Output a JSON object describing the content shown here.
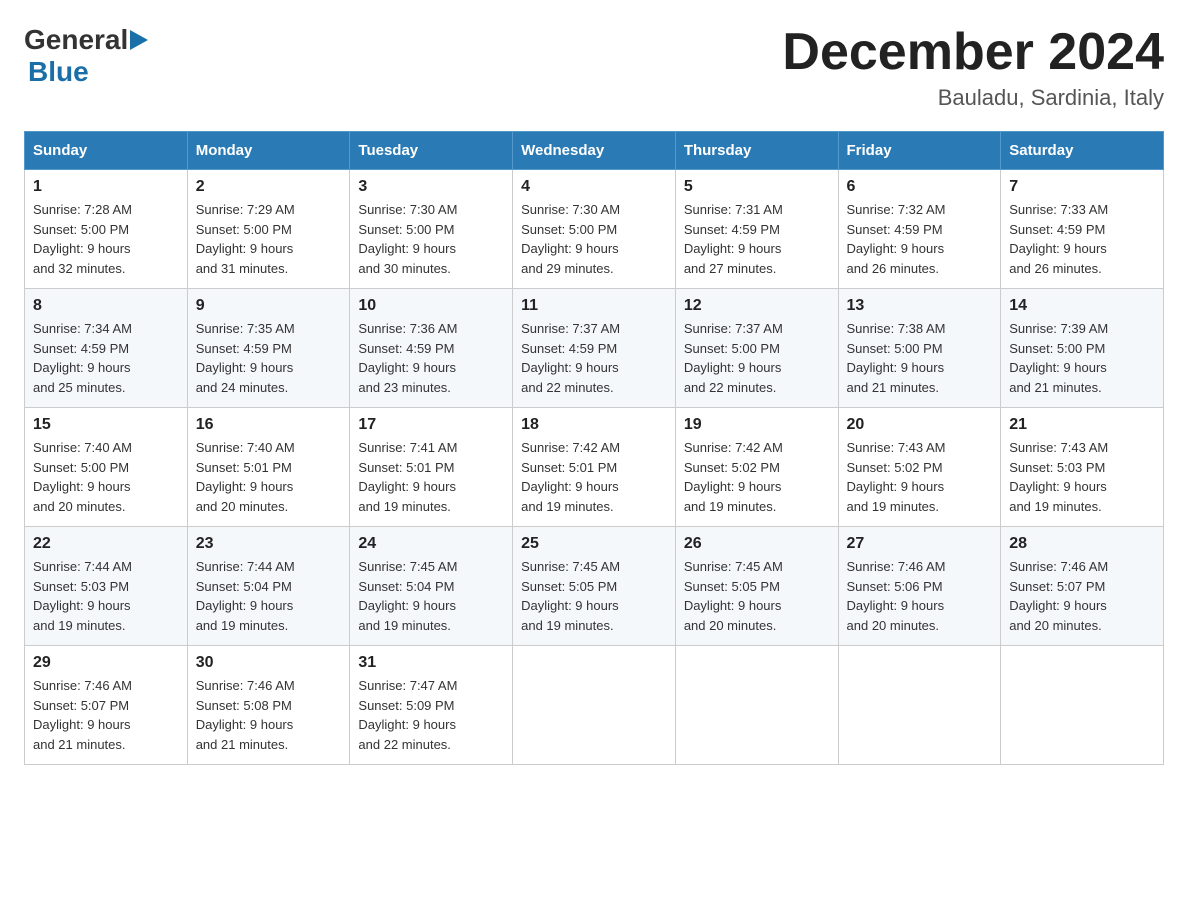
{
  "header": {
    "logo_general": "General",
    "logo_blue": "Blue",
    "title": "December 2024",
    "subtitle": "Bauladu, Sardinia, Italy"
  },
  "days_of_week": [
    "Sunday",
    "Monday",
    "Tuesday",
    "Wednesday",
    "Thursday",
    "Friday",
    "Saturday"
  ],
  "weeks": [
    [
      {
        "day": "1",
        "sunrise": "7:28 AM",
        "sunset": "5:00 PM",
        "daylight": "9 hours and 32 minutes."
      },
      {
        "day": "2",
        "sunrise": "7:29 AM",
        "sunset": "5:00 PM",
        "daylight": "9 hours and 31 minutes."
      },
      {
        "day": "3",
        "sunrise": "7:30 AM",
        "sunset": "5:00 PM",
        "daylight": "9 hours and 30 minutes."
      },
      {
        "day": "4",
        "sunrise": "7:30 AM",
        "sunset": "5:00 PM",
        "daylight": "9 hours and 29 minutes."
      },
      {
        "day": "5",
        "sunrise": "7:31 AM",
        "sunset": "4:59 PM",
        "daylight": "9 hours and 27 minutes."
      },
      {
        "day": "6",
        "sunrise": "7:32 AM",
        "sunset": "4:59 PM",
        "daylight": "9 hours and 26 minutes."
      },
      {
        "day": "7",
        "sunrise": "7:33 AM",
        "sunset": "4:59 PM",
        "daylight": "9 hours and 26 minutes."
      }
    ],
    [
      {
        "day": "8",
        "sunrise": "7:34 AM",
        "sunset": "4:59 PM",
        "daylight": "9 hours and 25 minutes."
      },
      {
        "day": "9",
        "sunrise": "7:35 AM",
        "sunset": "4:59 PM",
        "daylight": "9 hours and 24 minutes."
      },
      {
        "day": "10",
        "sunrise": "7:36 AM",
        "sunset": "4:59 PM",
        "daylight": "9 hours and 23 minutes."
      },
      {
        "day": "11",
        "sunrise": "7:37 AM",
        "sunset": "4:59 PM",
        "daylight": "9 hours and 22 minutes."
      },
      {
        "day": "12",
        "sunrise": "7:37 AM",
        "sunset": "5:00 PM",
        "daylight": "9 hours and 22 minutes."
      },
      {
        "day": "13",
        "sunrise": "7:38 AM",
        "sunset": "5:00 PM",
        "daylight": "9 hours and 21 minutes."
      },
      {
        "day": "14",
        "sunrise": "7:39 AM",
        "sunset": "5:00 PM",
        "daylight": "9 hours and 21 minutes."
      }
    ],
    [
      {
        "day": "15",
        "sunrise": "7:40 AM",
        "sunset": "5:00 PM",
        "daylight": "9 hours and 20 minutes."
      },
      {
        "day": "16",
        "sunrise": "7:40 AM",
        "sunset": "5:01 PM",
        "daylight": "9 hours and 20 minutes."
      },
      {
        "day": "17",
        "sunrise": "7:41 AM",
        "sunset": "5:01 PM",
        "daylight": "9 hours and 19 minutes."
      },
      {
        "day": "18",
        "sunrise": "7:42 AM",
        "sunset": "5:01 PM",
        "daylight": "9 hours and 19 minutes."
      },
      {
        "day": "19",
        "sunrise": "7:42 AM",
        "sunset": "5:02 PM",
        "daylight": "9 hours and 19 minutes."
      },
      {
        "day": "20",
        "sunrise": "7:43 AM",
        "sunset": "5:02 PM",
        "daylight": "9 hours and 19 minutes."
      },
      {
        "day": "21",
        "sunrise": "7:43 AM",
        "sunset": "5:03 PM",
        "daylight": "9 hours and 19 minutes."
      }
    ],
    [
      {
        "day": "22",
        "sunrise": "7:44 AM",
        "sunset": "5:03 PM",
        "daylight": "9 hours and 19 minutes."
      },
      {
        "day": "23",
        "sunrise": "7:44 AM",
        "sunset": "5:04 PM",
        "daylight": "9 hours and 19 minutes."
      },
      {
        "day": "24",
        "sunrise": "7:45 AM",
        "sunset": "5:04 PM",
        "daylight": "9 hours and 19 minutes."
      },
      {
        "day": "25",
        "sunrise": "7:45 AM",
        "sunset": "5:05 PM",
        "daylight": "9 hours and 19 minutes."
      },
      {
        "day": "26",
        "sunrise": "7:45 AM",
        "sunset": "5:05 PM",
        "daylight": "9 hours and 20 minutes."
      },
      {
        "day": "27",
        "sunrise": "7:46 AM",
        "sunset": "5:06 PM",
        "daylight": "9 hours and 20 minutes."
      },
      {
        "day": "28",
        "sunrise": "7:46 AM",
        "sunset": "5:07 PM",
        "daylight": "9 hours and 20 minutes."
      }
    ],
    [
      {
        "day": "29",
        "sunrise": "7:46 AM",
        "sunset": "5:07 PM",
        "daylight": "9 hours and 21 minutes."
      },
      {
        "day": "30",
        "sunrise": "7:46 AM",
        "sunset": "5:08 PM",
        "daylight": "9 hours and 21 minutes."
      },
      {
        "day": "31",
        "sunrise": "7:47 AM",
        "sunset": "5:09 PM",
        "daylight": "9 hours and 22 minutes."
      },
      null,
      null,
      null,
      null
    ]
  ],
  "labels": {
    "sunrise": "Sunrise:",
    "sunset": "Sunset:",
    "daylight": "Daylight:"
  }
}
